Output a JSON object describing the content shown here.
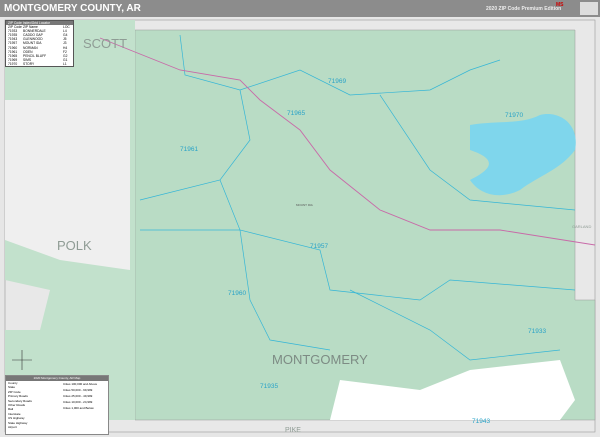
{
  "header": {
    "title": "MONTGOMERY COUNTY, AR",
    "edition": "2020 ZIP Code Premium Edition",
    "logo_text": "Map Sales"
  },
  "zip_index": {
    "title": "ZIP Code Index/Grid Locator",
    "columns": [
      "ZIP Code",
      "ZIP Name",
      "LOC"
    ],
    "rows": [
      [
        "71933",
        "BONNERDALE",
        "L4"
      ],
      [
        "71935",
        "CADDO GAP",
        "G4"
      ],
      [
        "71943",
        "GLENWOOD",
        "J5"
      ],
      [
        "71957",
        "MOUNT IDA",
        "J3"
      ],
      [
        "71960",
        "NORMAN",
        "H4"
      ],
      [
        "71961",
        "ODEN",
        "F2"
      ],
      [
        "71965",
        "PENCIL BLUFF",
        "G2"
      ],
      [
        "71969",
        "SIMS",
        "G1"
      ],
      [
        "71970",
        "STORY",
        "L1"
      ]
    ]
  },
  "map": {
    "county_label": "MONTGOMERY",
    "neighbors": [
      {
        "name": "SCOTT"
      },
      {
        "name": "POLK"
      },
      {
        "name": "PIKE"
      },
      {
        "name": "GARLAND"
      }
    ],
    "zip_labels": [
      "71969",
      "71970",
      "71965",
      "71961",
      "71957",
      "71960",
      "71933",
      "71935",
      "71943"
    ],
    "places": [
      "MOUNT IDA"
    ]
  },
  "legend": {
    "title": "2020 Montgomery County, AR Map",
    "items": [
      "County",
      "State",
      "ZIP Code",
      "Primary Roads",
      "Secondary Roads",
      "Other Roads",
      "Rail",
      "Interstate",
      "US Highway",
      "State Highway",
      "Airport"
    ],
    "pop": [
      "Cities 100,000 and Above",
      "Cities 50,000 - 99,999",
      "Cities 25,000 - 49,999",
      "Cities 10,000 - 24,999",
      "Cities 1,000 and Below"
    ]
  },
  "colors": {
    "county": "#b9dcc5",
    "outside": "#e6e6e6",
    "water": "#7fd6ec",
    "zip_line": "#36b6d6",
    "highway": "#c86aa8"
  }
}
